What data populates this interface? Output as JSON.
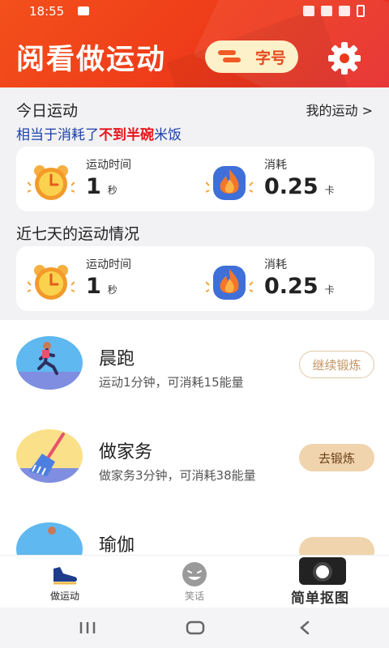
{
  "status_bar": {
    "time": "18:55"
  },
  "header": {
    "title": "阅看做运动",
    "font_button_label": "字号"
  },
  "today": {
    "title": "今日运动",
    "my_sport_link": "我的运动 >",
    "equiv_prefix": "相当于消耗了",
    "equiv_highlight": "不到半碗",
    "equiv_suffix": "米饭",
    "duration_label": "运动时间",
    "duration_value": "1",
    "duration_unit": "秒",
    "burn_label": "消耗",
    "burn_value": "0.25",
    "burn_unit": "卡"
  },
  "week": {
    "title": "近七天的运动情况",
    "duration_label": "运动时间",
    "duration_value": "1",
    "duration_unit": "秒",
    "burn_label": "消耗",
    "burn_value": "0.25",
    "burn_unit": "卡"
  },
  "activities": [
    {
      "name": "晨跑",
      "desc": "运动1分钟，可消耗15能量",
      "button": "继续锻炼"
    },
    {
      "name": "做家务",
      "desc": "做家务3分钟，可消耗38能量",
      "button": "去锻炼"
    },
    {
      "name": "瑜伽",
      "desc": "",
      "button": ""
    }
  ],
  "tabs": [
    {
      "label": "做运动",
      "icon": "sneaker-icon"
    },
    {
      "label": "笑话",
      "icon": "laughing-face-icon"
    }
  ],
  "watermark": {
    "text": "简单抠图"
  },
  "colors": {
    "header": "#ee3a1a",
    "accent_red": "#e8141b",
    "link_blue": "#1a3fa8",
    "button_gold": "#f0d4ad"
  }
}
